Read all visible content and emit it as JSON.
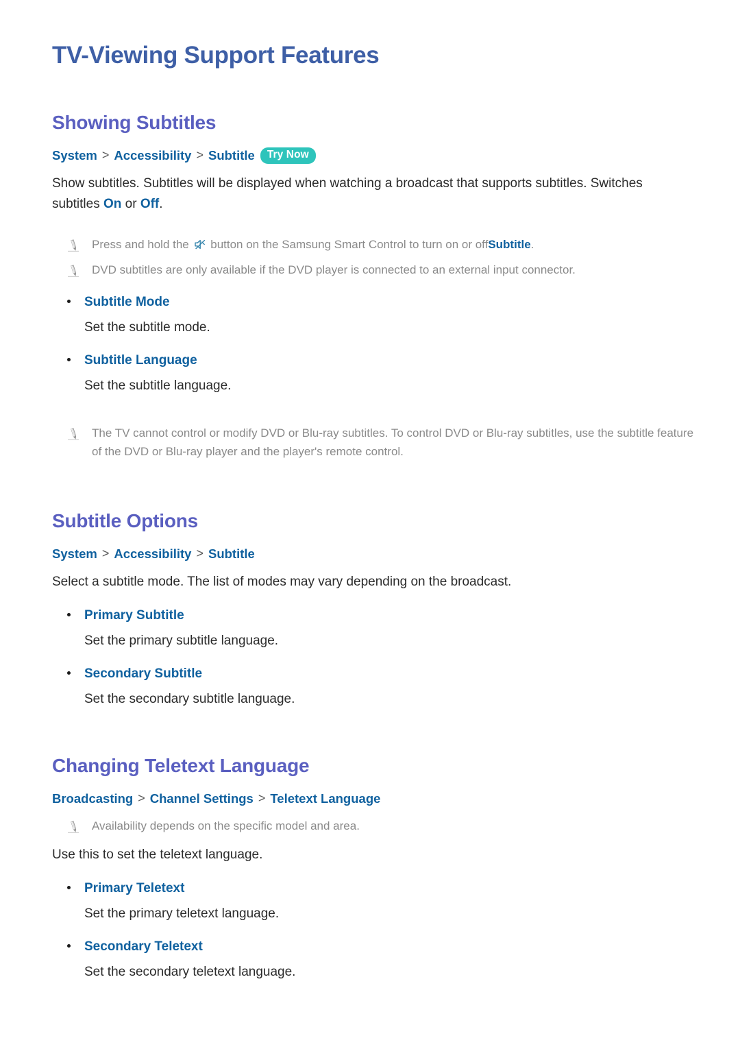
{
  "page": {
    "title": "TV-Viewing Support Features"
  },
  "sections": [
    {
      "heading": "Showing Subtitles",
      "breadcrumb": [
        "System",
        "Accessibility",
        "Subtitle"
      ],
      "badge": "Try Now",
      "paragraphs": [
        "Show subtitles. Subtitles will be displayed when watching a broadcast that supports subtitles. Switches subtitles On or Off."
      ],
      "paragraph_highlights": [
        "On",
        "Off"
      ],
      "notes": [
        {
          "icon": "pencil-icon",
          "text_before": "Press and hold the",
          "inline_icon": "mute-icon",
          "text_after": "button on the Samsung Smart Control to turn on or off",
          "highlight": "Subtitle",
          "text_end": "."
        },
        {
          "icon": "pencil-icon",
          "text": "DVD subtitles are only available if the DVD player is connected to an external input connector."
        }
      ],
      "bullets": [
        {
          "label": "Subtitle Mode",
          "desc": "Set the subtitle mode."
        },
        {
          "label": "Subtitle Language",
          "desc": "Set the subtitle language."
        }
      ],
      "footnotes": [
        {
          "icon": "pencil-icon",
          "text": "The TV cannot control or modify DVD or Blu-ray subtitles. To control DVD or Blu-ray subtitles, use the subtitle feature of the DVD or Blu-ray player and the player's remote control."
        }
      ]
    },
    {
      "heading": "Subtitle Options",
      "breadcrumb": [
        "System",
        "Accessibility",
        "Subtitle"
      ],
      "badge": null,
      "paragraphs": [
        "Select a subtitle mode. The list of modes may vary depending on the broadcast."
      ],
      "bullets": [
        {
          "label": "Primary Subtitle",
          "desc": "Set the primary subtitle language."
        },
        {
          "label": "Secondary Subtitle",
          "desc": "Set the secondary subtitle language."
        }
      ]
    },
    {
      "heading": "Changing Teletext Language",
      "breadcrumb": [
        "Broadcasting",
        "Channel Settings",
        "Teletext Language"
      ],
      "badge": null,
      "notes": [
        {
          "icon": "pencil-icon",
          "text": "Availability depends on the specific model and area."
        }
      ],
      "paragraphs": [
        "Use this to set the teletext language."
      ],
      "bullets": [
        {
          "label": "Primary Teletext",
          "desc": "Set the primary teletext language."
        },
        {
          "label": "Secondary Teletext",
          "desc": "Set the secondary teletext language."
        }
      ]
    }
  ],
  "colors": {
    "doc_title": "#3e5fa6",
    "section_title": "#5a5fc0",
    "link_blue": "#10619f",
    "badge_teal": "#2ec4bb",
    "note_gray": "#8a8a8a",
    "body_text": "#2b2b2b"
  },
  "separator": ">"
}
